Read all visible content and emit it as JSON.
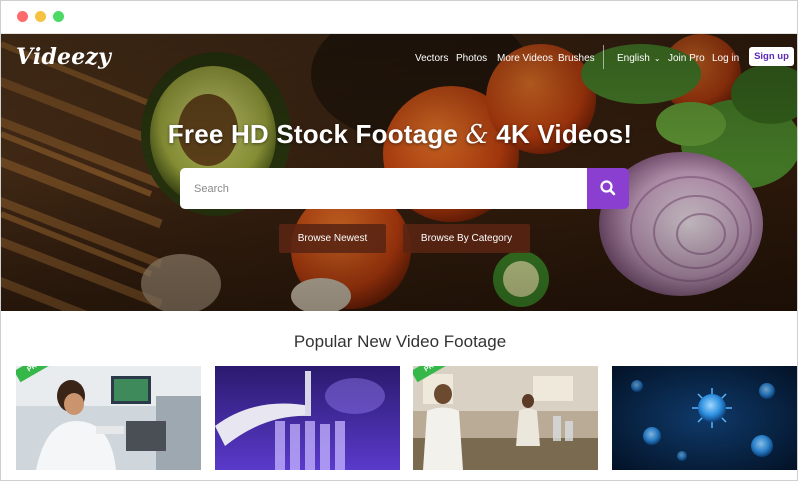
{
  "site": {
    "logo": "Videezy"
  },
  "nav": {
    "items": [
      "Vectors",
      "Photos",
      "More Videos",
      "Brushes"
    ],
    "language": "English",
    "join_pro": "Join Pro",
    "log_in": "Log in",
    "sign_up": "Sign up"
  },
  "hero": {
    "headline_part1": "Free HD Stock Footage",
    "headline_amp": "&",
    "headline_part2": "4K Videos!",
    "search_placeholder": "Search",
    "browse_newest": "Browse Newest",
    "browse_category": "Browse By Category"
  },
  "popular": {
    "title": "Popular New Video Footage",
    "thumbnails": [
      {
        "badge": "PRO"
      },
      {
        "badge": ""
      },
      {
        "badge": "PRO"
      },
      {
        "badge": ""
      }
    ]
  },
  "colors": {
    "accent": "#8a3fd1",
    "signup_text": "#5b2ab4",
    "pro_badge": "#35b849",
    "browse_button": "#5a2412"
  }
}
